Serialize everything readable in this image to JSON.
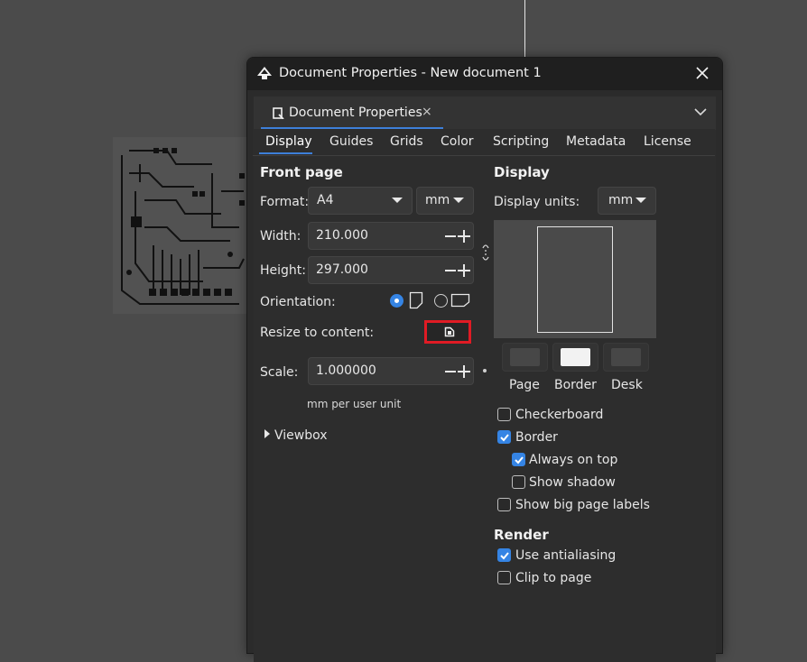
{
  "window": {
    "title": "Document Properties - New document 1"
  },
  "notebook": {
    "tab_label": "Document Properties",
    "tab_close": "×"
  },
  "subtabs": [
    "Display",
    "Guides",
    "Grids",
    "Color",
    "Scripting",
    "Metadata",
    "License"
  ],
  "front_page": {
    "title": "Front page",
    "format_label": "Format:",
    "format_value": "A4",
    "format_unit": "mm",
    "width_label": "Width:",
    "width_value": "210.000",
    "height_label": "Height:",
    "height_value": "297.000",
    "orientation_label": "Orientation:",
    "orientation_selected": "portrait",
    "resize_label": "Resize to content:",
    "scale_label": "Scale:",
    "scale_value": "1.000000",
    "scale_note": "mm per user unit",
    "viewbox_label": "Viewbox"
  },
  "display": {
    "title": "Display",
    "units_label": "Display units:",
    "units_value": "mm",
    "colors": [
      {
        "label": "Page",
        "color": "#474747"
      },
      {
        "label": "Border",
        "color": "#f2f2f2"
      },
      {
        "label": "Desk",
        "color": "#474747"
      }
    ],
    "options": [
      {
        "label": "Checkerboard",
        "checked": false
      },
      {
        "label": "Border",
        "checked": true
      },
      {
        "label": "Always on top",
        "checked": true
      },
      {
        "label": "Show shadow",
        "checked": false
      },
      {
        "label": "Show big page labels",
        "checked": false
      }
    ]
  },
  "render": {
    "title": "Render",
    "options": [
      {
        "label": "Use antialiasing",
        "checked": true
      },
      {
        "label": "Clip to page",
        "checked": false
      }
    ]
  },
  "colors": {
    "accent": "#3584e4",
    "highlight_box": "#e01b24",
    "tab_underline": "#3d7fd9"
  }
}
